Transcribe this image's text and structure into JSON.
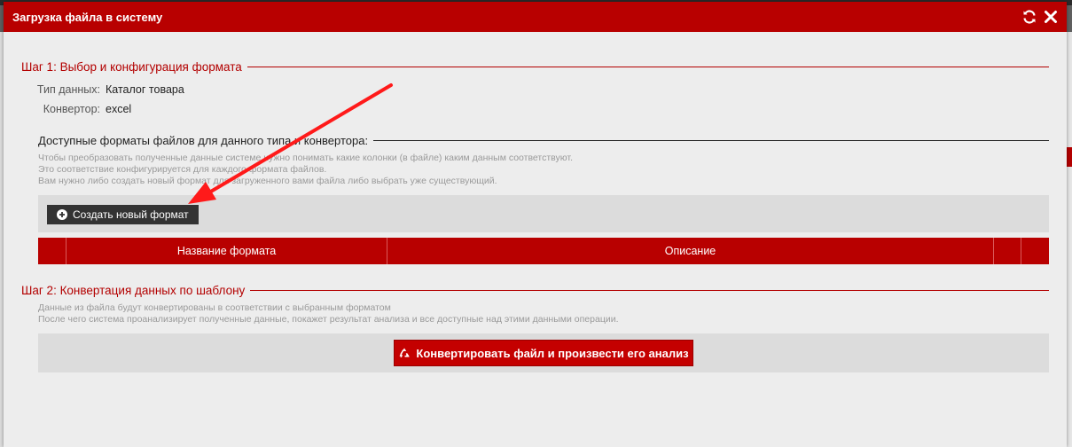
{
  "modal": {
    "title": "Загрузка файла в систему",
    "refresh_icon": "refresh-icon",
    "close_icon": "close-icon"
  },
  "step1": {
    "legend": "Шаг 1: Выбор и конфигурация формата",
    "data_type_label": "Тип данных:",
    "data_type_value": "Каталог товара",
    "converter_label": "Конвертор:",
    "converter_value": "excel",
    "formats_heading": "Доступные форматы файлов для данного типа и конвертора:",
    "hint_lines": [
      "Чтобы преобразовать полученные данные системе нужно понимать какие колонки (в файле) каким данным соответствуют.",
      "Это соответствие конфигурируется для каждого формата файлов.",
      "Вам нужно либо создать новый формат для загруженного вами файла либо выбрать уже существующий."
    ],
    "create_button": "Создать новый формат",
    "table_headers": [
      "",
      "Название формата",
      "Описание",
      "",
      ""
    ]
  },
  "step2": {
    "legend": "Шаг 2: Конвертация данных по шаблону",
    "hint_lines": [
      "Данные из файла будут конвертированы в соответствии с выбранным форматом",
      "После чего система проанализирует полученные данные, покажет результат анализа и все доступные над этими данными операции."
    ],
    "convert_button": "Конвертировать файл и произвести его анализ"
  },
  "colors": {
    "accent": "#b80000",
    "legend": "#b30000",
    "dark_button": "#333333",
    "annotation_arrow": "#ff1a1a"
  }
}
